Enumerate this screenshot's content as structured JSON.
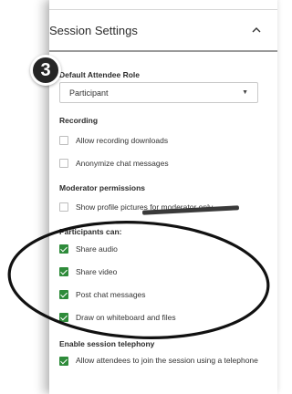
{
  "panel": {
    "title": "Session Settings",
    "collapse_icon": "chevron-up-icon"
  },
  "step_badge": "3",
  "default_role": {
    "heading": "Default Attendee Role",
    "value": "Participant"
  },
  "recording": {
    "heading": "Recording",
    "options": [
      {
        "label": "Allow recording downloads",
        "checked": false
      },
      {
        "label": "Anonymize chat messages",
        "checked": false
      }
    ]
  },
  "moderator": {
    "heading": "Moderator permissions",
    "options": [
      {
        "label": "Show profile pictures for moderator only",
        "checked": false
      }
    ]
  },
  "participants": {
    "heading": "Participants can:",
    "options": [
      {
        "label": "Share audio",
        "checked": true
      },
      {
        "label": "Share video",
        "checked": true
      },
      {
        "label": "Post chat messages",
        "checked": true
      },
      {
        "label": "Draw on whiteboard and files",
        "checked": true
      }
    ]
  },
  "telephony": {
    "heading": "Enable session telephony",
    "options": [
      {
        "label": "Allow attendees to join the session using a telephone",
        "checked": true
      }
    ]
  },
  "colors": {
    "check_green": "#2e8b3a",
    "annotation": "#111111"
  }
}
